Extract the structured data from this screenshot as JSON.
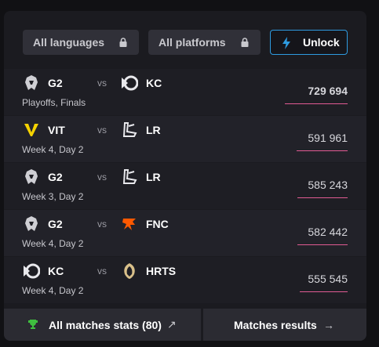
{
  "filters": {
    "languages": "All languages",
    "platforms": "All platforms",
    "unlock": "Unlock"
  },
  "matches": [
    {
      "team1": "G2",
      "team2": "KC",
      "vs": "vs",
      "stage": "Playoffs, Finals",
      "viewers": "729 694",
      "fill": 1.0
    },
    {
      "team1": "VIT",
      "team2": "LR",
      "vs": "vs",
      "stage": "Week 4, Day 2",
      "viewers": "591 961",
      "fill": 0.81
    },
    {
      "team1": "G2",
      "team2": "LR",
      "vs": "vs",
      "stage": "Week 3, Day 2",
      "viewers": "585 243",
      "fill": 0.8
    },
    {
      "team1": "G2",
      "team2": "FNC",
      "vs": "vs",
      "stage": "Week 4, Day 2",
      "viewers": "582 442",
      "fill": 0.8
    },
    {
      "team1": "KC",
      "team2": "HRTS",
      "vs": "vs",
      "stage": "Week 4, Day 2",
      "viewers": "555 545",
      "fill": 0.76
    }
  ],
  "footer": {
    "stats": "All matches stats (80)",
    "results": "Matches results"
  },
  "colors": {
    "accent_blue": "#2e9be0",
    "viewer_bar": "#e15b93",
    "trophy": "#3fbf3f",
    "fnatic": "#ff5900",
    "vitality": "#f5d200"
  }
}
